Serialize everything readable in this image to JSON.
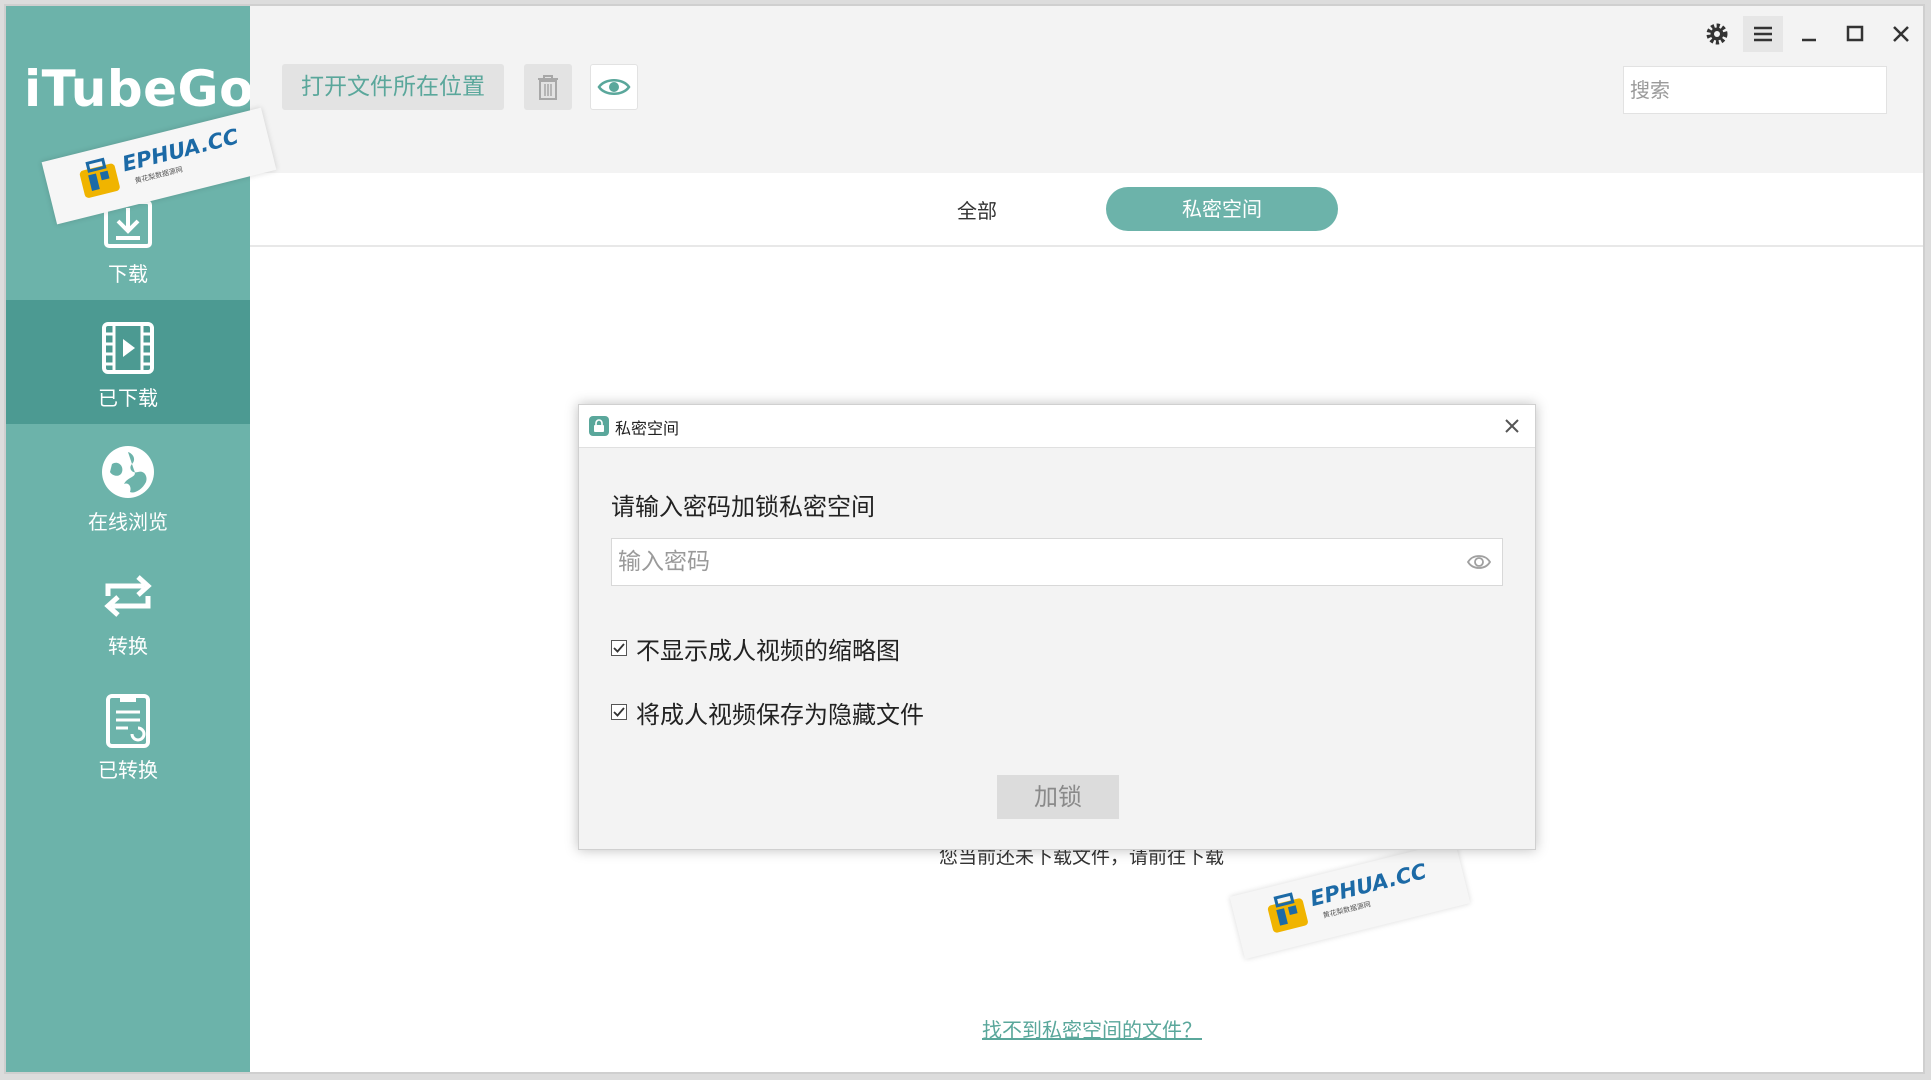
{
  "app": {
    "logo_text": "iTubeGo"
  },
  "sidebar": {
    "items": [
      {
        "label": "下载",
        "icon": "download-icon",
        "active": false
      },
      {
        "label": "已下载",
        "icon": "film-icon",
        "active": true
      },
      {
        "label": "在线浏览",
        "icon": "globe-icon",
        "active": false
      },
      {
        "label": "转换",
        "icon": "convert-icon",
        "active": false
      },
      {
        "label": "已转换",
        "icon": "converted-list-icon",
        "active": false
      }
    ]
  },
  "toolbar": {
    "open_location_label": "打开文件所在位置",
    "delete_icon": "trash-icon",
    "preview_icon": "eye-icon",
    "search_placeholder": "搜索"
  },
  "window_controls": [
    "gear-icon",
    "menu-icon",
    "minimize-icon",
    "maximize-icon",
    "close-icon"
  ],
  "tabs": {
    "all_label": "全部",
    "private_label": "私密空间"
  },
  "main": {
    "empty_text": "您当前还未下载文件，请前往下载",
    "help_link": "找不到私密空间的文件？"
  },
  "dialog": {
    "title": "私密空间",
    "prompt": "请输入密码加锁私密空间",
    "password_placeholder": "输入密码",
    "options": [
      {
        "label": "不显示成人视频的缩略图",
        "checked": true
      },
      {
        "label": "将成人视频保存为隐藏文件",
        "checked": true
      }
    ],
    "lock_button": "加锁"
  },
  "watermark": {
    "text": "EPHUA.CC",
    "subtext": "黄花梨数据源网"
  },
  "colors": {
    "accent": "#6cb3aa",
    "accent_dark": "#4c9a92",
    "accent_text": "#5aa79b"
  }
}
